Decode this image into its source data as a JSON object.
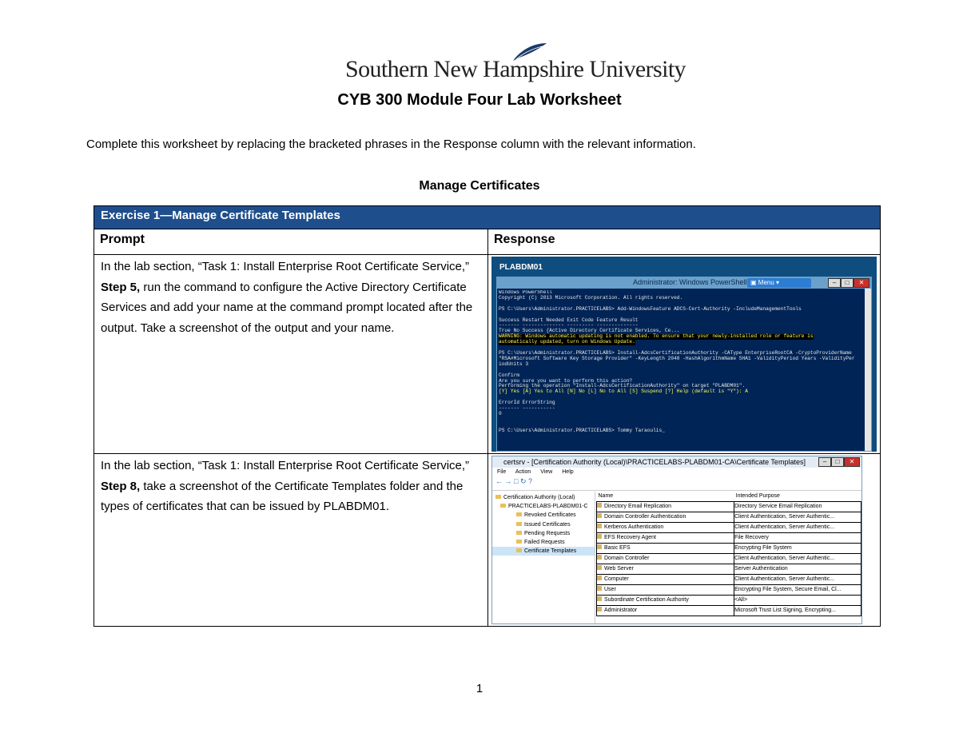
{
  "logo": {
    "text": "Southern New Hampshire University"
  },
  "title": "CYB 300 Module Four Lab Worksheet",
  "intro": "Complete this worksheet by replacing the bracketed phrases in the Response column with the relevant information.",
  "section_title": "Manage Certificates",
  "table": {
    "exercise_header": "Exercise 1—Manage Certificate Templates",
    "prompt_header": "Prompt",
    "response_header": "Response",
    "row1": {
      "prompt_a": "In the lab section, “Task 1: Install Enterprise Root Certificate Service,” ",
      "prompt_step": "Step 5,",
      "prompt_b": " run the command to configure the Active Directory Certificate Services and add your name at the command prompt located after the output. Take a screenshot of the output and your name."
    },
    "row2": {
      "prompt_a": "In the lab section, “Task 1: Install Enterprise Root Certificate Service,” ",
      "prompt_step": "Step 8,",
      "prompt_b": " take a screenshot of the Certificate Templates folder and the types of certificates that can be issued by PLABDM01."
    }
  },
  "screenshot1": {
    "host_label": "PLABDM01",
    "window_title": "Administrator: Windows PowerShell",
    "menu_label": "Menu",
    "lines": [
      "Windows PowerShell",
      "Copyright (C) 2013 Microsoft Corporation. All rights reserved.",
      "",
      "PS C:\\Users\\Administrator.PRACTICELABS> Add-WindowsFeature ADCS-Cert-Authority -IncludeManagementTools",
      "",
      "Success Restart Needed Exit Code      Feature Result",
      "------- -------------- ---------      --------------",
      "True    No             Success        {Active Directory Certificate Services, Ce..."
    ],
    "warning_lines": [
      "WARNING: Windows automatic updating is not enabled. To ensure that your newly-installed role or feature is",
      "automatically updated, turn on Windows Update."
    ],
    "lines2": [
      "",
      "PS C:\\Users\\Administrator.PRACTICELABS> Install-AdcsCertificationAuthority -CAType EnterpriseRootCA -CryptoProviderName",
      "\"RSA#Microsoft Software Key Storage Provider\" -KeyLength 2048 -HashAlgorithmName SHA1 -ValidityPeriod Years -ValidityPer",
      "iodUnits 3",
      "",
      "Confirm",
      "Are you sure you want to perform this action?",
      "Performing the operation \"Install-AdcsCertificationAuthority\" on target \"PLABDM01\"."
    ],
    "confirm_line": "[Y] Yes  [A] Yes to All  [N] No  [L] No to All  [S] Suspend  [?] Help (default is \"Y\"): A",
    "lines3": [
      "",
      "                                    ErrorId ErrorString",
      "                                    ------- -----------",
      "                                          0",
      "",
      "",
      "PS C:\\Users\\Administrator.PRACTICELABS> Tommy Taraoulis_"
    ]
  },
  "screenshot2": {
    "window_title": "certsrv - [Certification Authority (Local)\\PRACTICELABS-PLABDM01-CA\\Certificate Templates]",
    "menu": [
      "File",
      "Action",
      "View",
      "Help"
    ],
    "tree": [
      "Certification Authority (Local)",
      "PRACTICELABS-PLABDM01-C",
      "Revoked Certificates",
      "Issued Certificates",
      "Pending Requests",
      "Failed Requests",
      "Certificate Templates"
    ],
    "columns": [
      "Name",
      "Intended Purpose"
    ],
    "rows": [
      [
        "Directory Email Replication",
        "Directory Service Email Replication"
      ],
      [
        "Domain Controller Authentication",
        "Client Authentication, Server Authentic..."
      ],
      [
        "Kerberos Authentication",
        "Client Authentication, Server Authentic..."
      ],
      [
        "EFS Recovery Agent",
        "File Recovery"
      ],
      [
        "Basic EFS",
        "Encrypting File System"
      ],
      [
        "Domain Controller",
        "Client Authentication, Server Authentic..."
      ],
      [
        "Web Server",
        "Server Authentication"
      ],
      [
        "Computer",
        "Client Authentication, Server Authentic..."
      ],
      [
        "User",
        "Encrypting File System, Secure Email, Cl..."
      ],
      [
        "Subordinate Certification Authority",
        "<All>"
      ],
      [
        "Administrator",
        "Microsoft Trust List Signing, Encrypting..."
      ]
    ]
  },
  "page_number": "1",
  "colors": {
    "header_blue": "#1f4e8c",
    "ps_bg": "#012456"
  }
}
